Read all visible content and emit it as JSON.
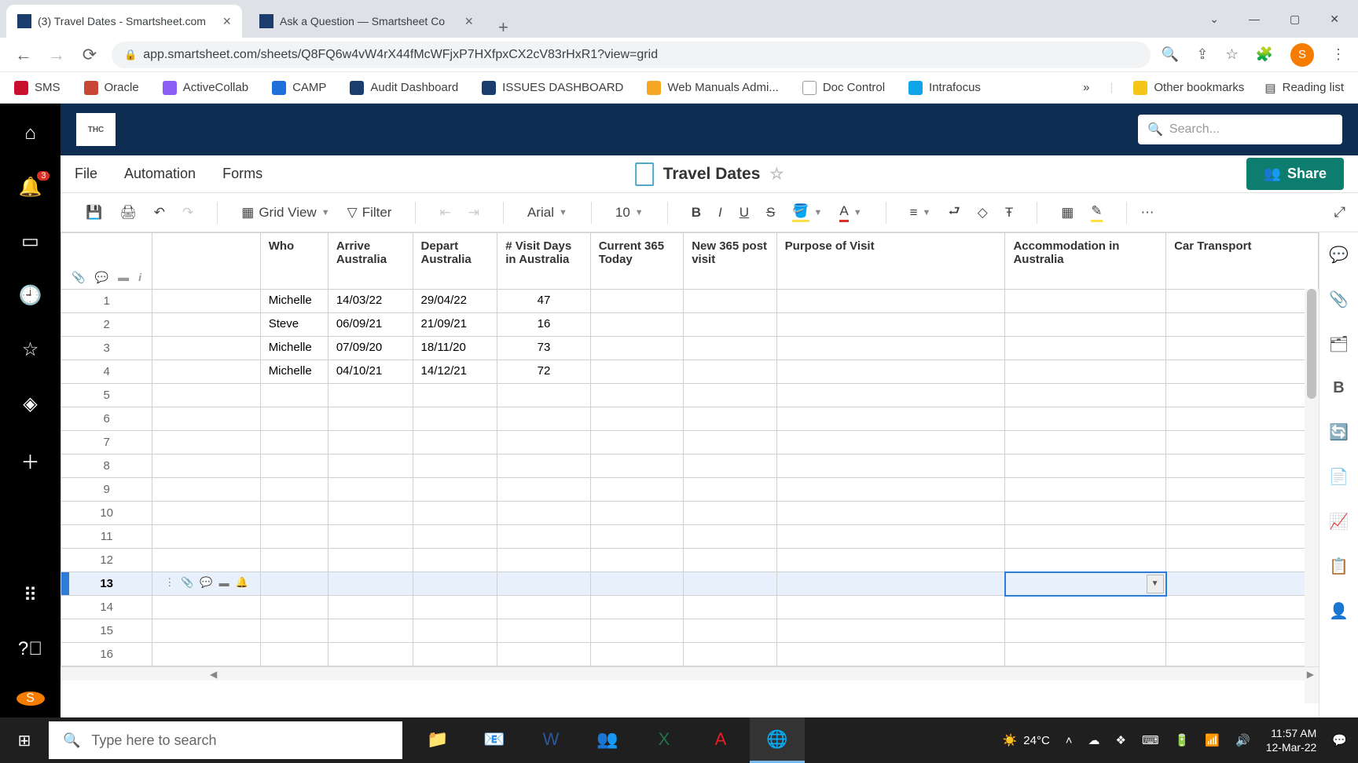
{
  "browser": {
    "tabs": [
      {
        "title": "(3) Travel Dates - Smartsheet.com",
        "active": true
      },
      {
        "title": "Ask a Question — Smartsheet Co",
        "active": false
      }
    ],
    "url": "app.smartsheet.com/sheets/Q8FQ6w4vW4rX44fMcWFjxP7HXfpxCX2cV83rHxR1?view=grid",
    "profile_letter": "S",
    "bookmarks": [
      "SMS",
      "Oracle",
      "ActiveCollab",
      "CAMP",
      "Audit Dashboard",
      "ISSUES DASHBOARD",
      "Web Manuals Admi...",
      "Doc Control",
      "Intrafocus"
    ],
    "other_bookmarks": "Other bookmarks",
    "reading_list": "Reading list"
  },
  "app": {
    "logo_text": "THC",
    "search_placeholder": "Search...",
    "notification_count": "3",
    "menus": [
      "File",
      "Automation",
      "Forms"
    ],
    "sheet_title": "Travel Dates",
    "share_label": "Share",
    "toolbar": {
      "view_label": "Grid View",
      "filter_label": "Filter",
      "font_name": "Arial",
      "font_size": "10"
    },
    "columns": [
      "Who",
      "Arrive Australia",
      "Depart Australia",
      "# Visit Days in Australia",
      "Current 365 Today",
      "New 365 post visit",
      "Purpose of Visit",
      "Accommodation in Australia",
      "Car Transport"
    ],
    "rows": [
      {
        "n": "1",
        "who": "Michelle",
        "arrive": "14/03/22",
        "depart": "29/04/22",
        "days": "47"
      },
      {
        "n": "2",
        "who": "Steve",
        "arrive": "06/09/21",
        "depart": "21/09/21",
        "days": "16"
      },
      {
        "n": "3",
        "who": "Michelle",
        "arrive": "07/09/20",
        "depart": "18/11/20",
        "days": "73"
      },
      {
        "n": "4",
        "who": "Michelle",
        "arrive": "04/10/21",
        "depart": "14/12/21",
        "days": "72"
      }
    ],
    "empty_rows": [
      "5",
      "6",
      "7",
      "8",
      "9",
      "10",
      "11",
      "12"
    ],
    "selected_row": "13",
    "trailing_rows": [
      "14",
      "15",
      "16"
    ],
    "rail_profile_letter": "S"
  },
  "taskbar": {
    "search_placeholder": "Type here to search",
    "weather": "24°C",
    "time": "11:57 AM",
    "date": "12-Mar-22"
  }
}
